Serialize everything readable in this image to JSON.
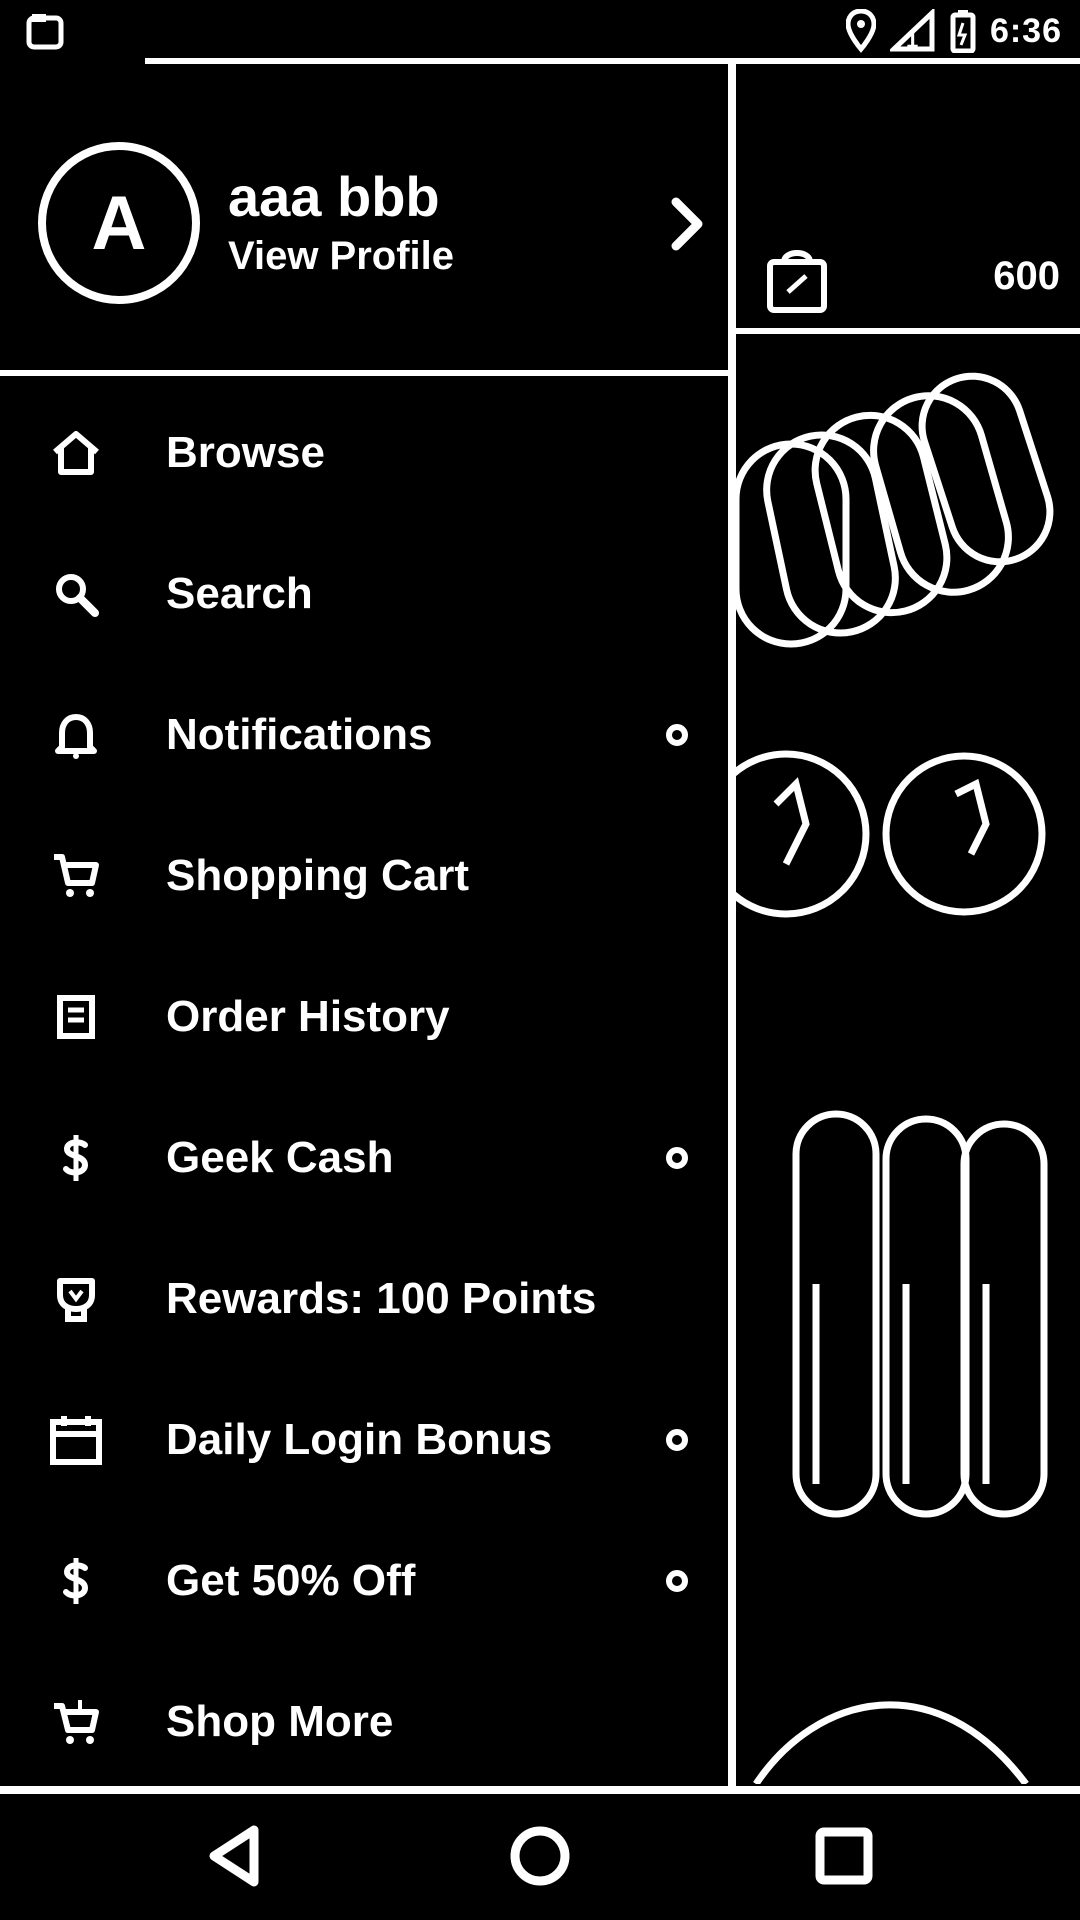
{
  "status_bar": {
    "time": "6:36",
    "icons": [
      "app-notification-icon",
      "location-icon",
      "signal-icon",
      "battery-icon"
    ]
  },
  "profile": {
    "avatar_letter": "A",
    "name": "aaa bbb",
    "link_label": "View Profile"
  },
  "menu": {
    "items": [
      {
        "label": "Browse",
        "icon": "home-icon",
        "dot": false
      },
      {
        "label": "Search",
        "icon": "search-icon",
        "dot": false
      },
      {
        "label": "Notifications",
        "icon": "bell-icon",
        "dot": true
      },
      {
        "label": "Shopping Cart",
        "icon": "cart-icon",
        "dot": false
      },
      {
        "label": "Order History",
        "icon": "order-history-icon",
        "dot": false
      },
      {
        "label": "Geek Cash",
        "icon": "dollar-icon",
        "dot": true
      },
      {
        "label": "Rewards: 100 Points",
        "icon": "rewards-icon",
        "dot": false
      },
      {
        "label": "Daily Login Bonus",
        "icon": "calendar-icon",
        "dot": true
      },
      {
        "label": "Get 50% Off",
        "icon": "dollar-icon",
        "dot": true
      },
      {
        "label": "Shop More",
        "icon": "cart-more-icon",
        "dot": false
      }
    ]
  },
  "background": {
    "cart_count": "600"
  },
  "nav_bar": {
    "buttons": [
      "back-icon",
      "home-circle-icon",
      "recents-icon"
    ]
  }
}
